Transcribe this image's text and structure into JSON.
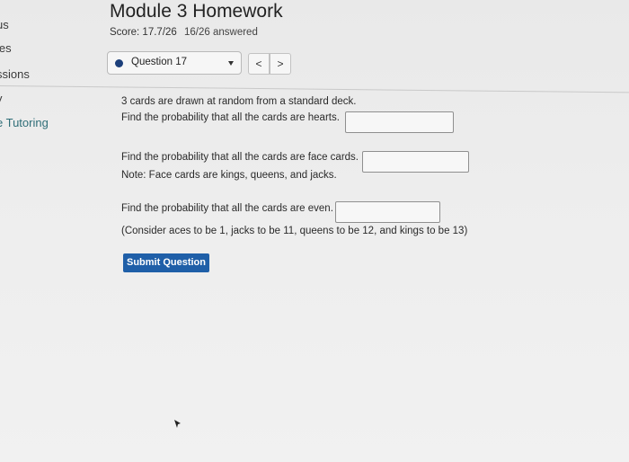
{
  "sidebar": {
    "items": [
      {
        "label": "us"
      },
      {
        "label": "les"
      },
      {
        "label": "ssions"
      },
      {
        "label": "y"
      },
      {
        "label": "e Tutoring"
      }
    ]
  },
  "header": {
    "title": "Module 3 Homework",
    "score": "Score: 17.7/26",
    "answered": "16/26 answered"
  },
  "question_nav": {
    "selected": "Question 17",
    "prev_symbol": "<",
    "next_symbol": ">"
  },
  "question": {
    "intro": "3 cards are drawn at random from a standard deck.",
    "parts": [
      {
        "prompt": "Find the probability that all the cards are hearts.",
        "answer": "",
        "note": ""
      },
      {
        "prompt": "Find the probability that all the cards are face cards.",
        "answer": "",
        "note": "Note: Face cards are kings, queens, and jacks."
      },
      {
        "prompt": "Find the probability that all the cards are even.",
        "answer": "",
        "note": "(Consider aces to be 1, jacks to be 11, queens to be 12, and kings to be 13)"
      }
    ],
    "submit_label": "Submit Question"
  },
  "colors": {
    "submit_bg": "#1f5fa8",
    "question_dot": "#1c3f7a",
    "sidebar_link": "#2f6e78"
  }
}
